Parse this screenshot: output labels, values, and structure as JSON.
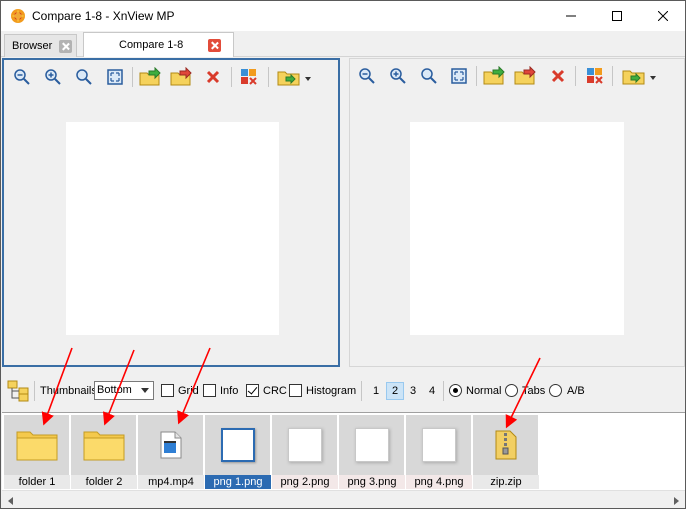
{
  "window": {
    "title": "Compare 1-8 - XnView MP"
  },
  "tabs": [
    {
      "label": "Browser",
      "active": false
    },
    {
      "label": "Compare 1-8",
      "active": true
    }
  ],
  "toolbar_icons": [
    "zoom-out-icon",
    "zoom-in-icon",
    "zoom-fit-icon",
    "fullscreen-icon",
    "copy-to-icon",
    "move-to-icon",
    "delete-icon",
    "mark-icon",
    "folder-dropdown-icon"
  ],
  "options": {
    "thumbnails_label": "Thumbnails",
    "thumbnails_position": "Bottom",
    "grid_label": "Grid",
    "grid_checked": false,
    "info_label": "Info",
    "info_checked": false,
    "crc_label": "CRC",
    "crc_checked": true,
    "histogram_label": "Histogram",
    "histogram_checked": false,
    "pages": [
      "1",
      "2",
      "3",
      "4"
    ],
    "active_page": "2",
    "mode_normal": "Normal",
    "mode_tabs": "Tabs",
    "mode_ab": "A/B",
    "selected_mode": "Normal"
  },
  "thumbnails": [
    {
      "label": "folder 1",
      "type": "folder"
    },
    {
      "label": "folder 2",
      "type": "folder"
    },
    {
      "label": "mp4.mp4",
      "type": "video"
    },
    {
      "label": "png 1.png",
      "type": "image",
      "selected": true
    },
    {
      "label": "png 2.png",
      "type": "image"
    },
    {
      "label": "png 3.png",
      "type": "image"
    },
    {
      "label": "png 4.png",
      "type": "image"
    },
    {
      "label": "zip.zip",
      "type": "archive"
    }
  ],
  "colors": {
    "accent": "#3a6ea5",
    "selection": "#2c6bb2",
    "annotation": "#ff0000",
    "close_tab": "#e24c3a"
  }
}
